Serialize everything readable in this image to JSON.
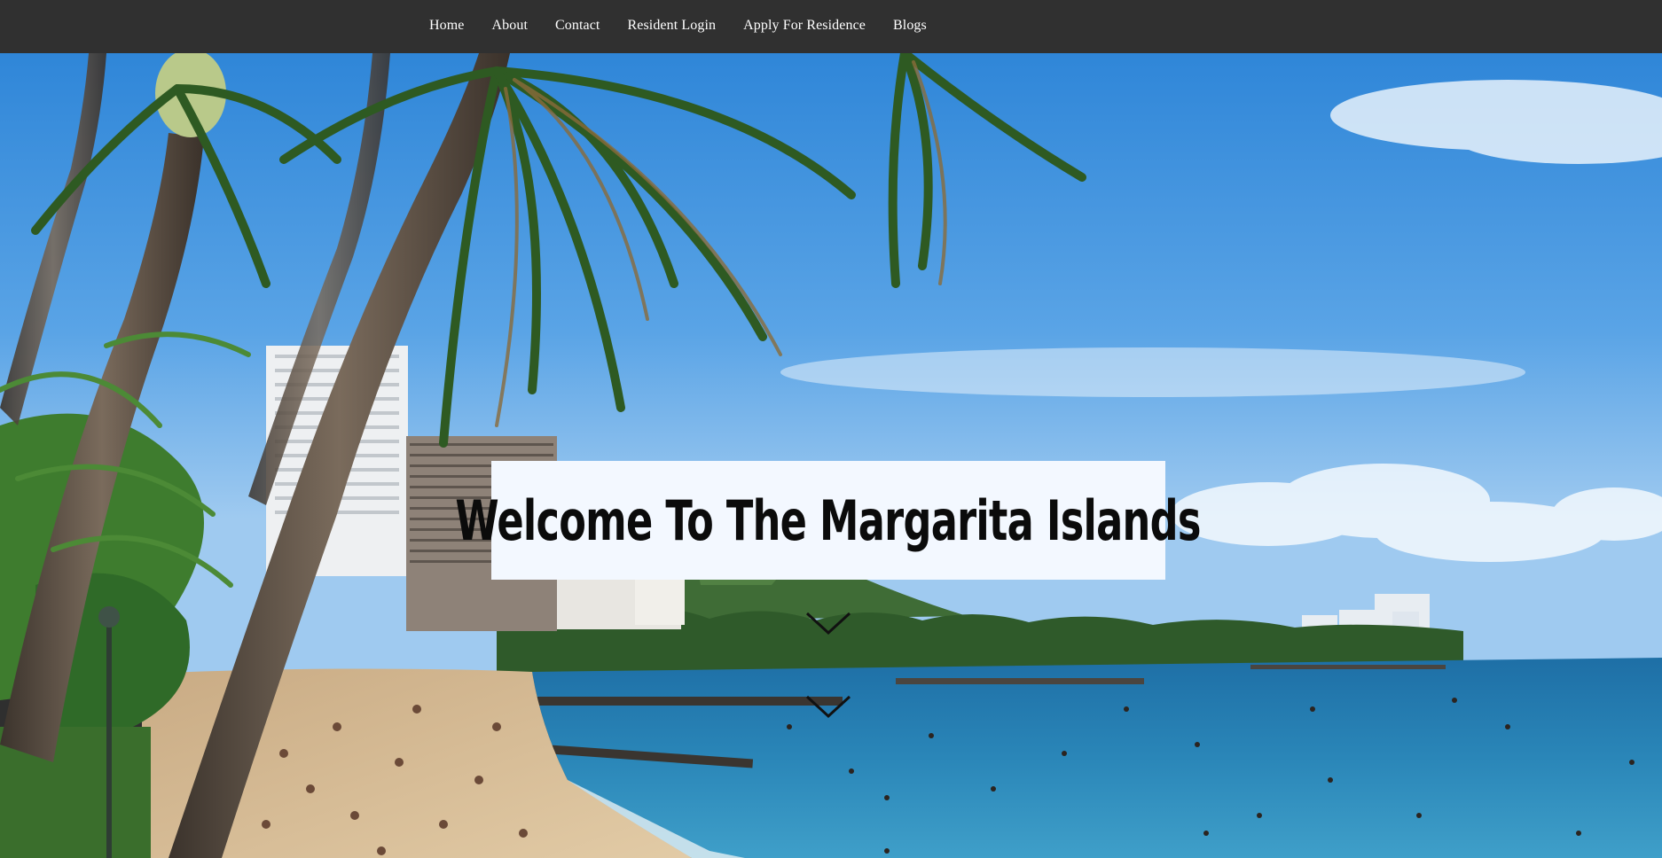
{
  "nav": {
    "items": [
      {
        "label": "Home"
      },
      {
        "label": "About"
      },
      {
        "label": "Contact"
      },
      {
        "label": "Resident Login"
      },
      {
        "label": "Apply For Residence"
      },
      {
        "label": "Blogs"
      }
    ]
  },
  "hero": {
    "title": "Welcome To The Margarita Islands",
    "scroll_icons": [
      "chevron-down-icon",
      "chevron-down-icon"
    ]
  },
  "colors": {
    "navbar_bg": "#303030",
    "nav_text": "#ffffff",
    "title_box_bg": "#f3f8ff",
    "title_text": "#0b0b0b"
  }
}
